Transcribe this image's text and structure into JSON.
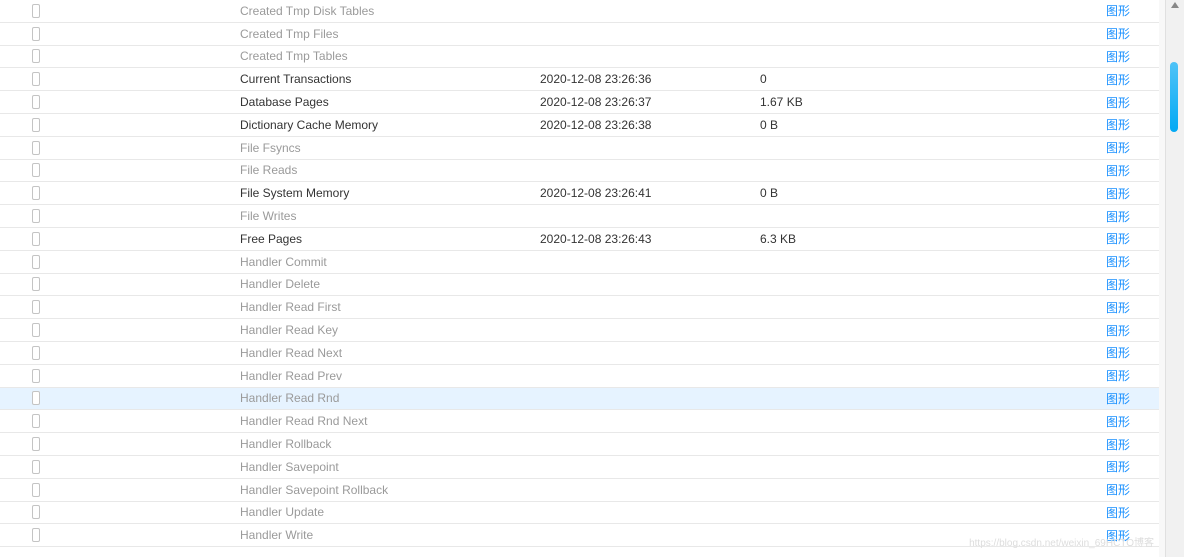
{
  "action_label": "图形",
  "watermark": "https://blog.csdn.net/weixin_69HCTO博客",
  "rows": [
    {
      "name": "Created Tmp Disk Tables",
      "time": "",
      "value": "",
      "muted": true,
      "hovered": false
    },
    {
      "name": "Created Tmp Files",
      "time": "",
      "value": "",
      "muted": true,
      "hovered": false
    },
    {
      "name": "Created Tmp Tables",
      "time": "",
      "value": "",
      "muted": true,
      "hovered": false
    },
    {
      "name": "Current Transactions",
      "time": "2020-12-08 23:26:36",
      "value": "0",
      "muted": false,
      "hovered": false
    },
    {
      "name": "Database Pages",
      "time": "2020-12-08 23:26:37",
      "value": "1.67 KB",
      "muted": false,
      "hovered": false
    },
    {
      "name": "Dictionary Cache Memory",
      "time": "2020-12-08 23:26:38",
      "value": "0 B",
      "muted": false,
      "hovered": false
    },
    {
      "name": "File Fsyncs",
      "time": "",
      "value": "",
      "muted": true,
      "hovered": false
    },
    {
      "name": "File Reads",
      "time": "",
      "value": "",
      "muted": true,
      "hovered": false
    },
    {
      "name": "File System Memory",
      "time": "2020-12-08 23:26:41",
      "value": "0 B",
      "muted": false,
      "hovered": false
    },
    {
      "name": "File Writes",
      "time": "",
      "value": "",
      "muted": true,
      "hovered": false
    },
    {
      "name": "Free Pages",
      "time": "2020-12-08 23:26:43",
      "value": "6.3 KB",
      "muted": false,
      "hovered": false
    },
    {
      "name": "Handler Commit",
      "time": "",
      "value": "",
      "muted": true,
      "hovered": false
    },
    {
      "name": "Handler Delete",
      "time": "",
      "value": "",
      "muted": true,
      "hovered": false
    },
    {
      "name": "Handler Read First",
      "time": "",
      "value": "",
      "muted": true,
      "hovered": false
    },
    {
      "name": "Handler Read Key",
      "time": "",
      "value": "",
      "muted": true,
      "hovered": false
    },
    {
      "name": "Handler Read Next",
      "time": "",
      "value": "",
      "muted": true,
      "hovered": false
    },
    {
      "name": "Handler Read Prev",
      "time": "",
      "value": "",
      "muted": true,
      "hovered": false
    },
    {
      "name": "Handler Read Rnd",
      "time": "",
      "value": "",
      "muted": true,
      "hovered": true
    },
    {
      "name": "Handler Read Rnd Next",
      "time": "",
      "value": "",
      "muted": true,
      "hovered": false
    },
    {
      "name": "Handler Rollback",
      "time": "",
      "value": "",
      "muted": true,
      "hovered": false
    },
    {
      "name": "Handler Savepoint",
      "time": "",
      "value": "",
      "muted": true,
      "hovered": false
    },
    {
      "name": "Handler Savepoint Rollback",
      "time": "",
      "value": "",
      "muted": true,
      "hovered": false
    },
    {
      "name": "Handler Update",
      "time": "",
      "value": "",
      "muted": true,
      "hovered": false
    },
    {
      "name": "Handler Write",
      "time": "",
      "value": "",
      "muted": true,
      "hovered": false
    }
  ]
}
